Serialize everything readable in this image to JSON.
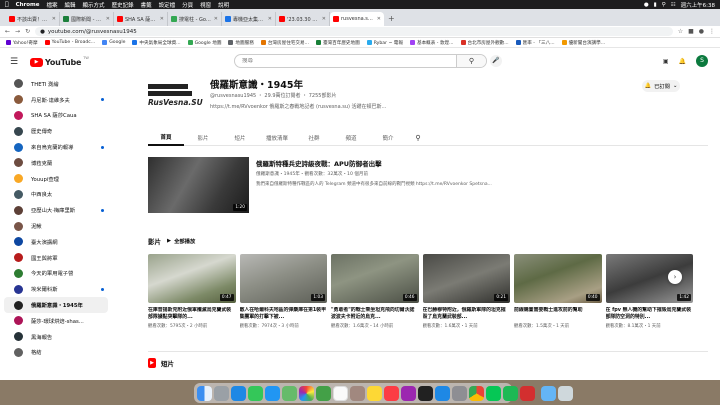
{
  "menubar": {
    "app": "Chrome",
    "items": [
      "檔案",
      "編輯",
      "顯示方式",
      "歷史記錄",
      "書籤",
      "設定檔",
      "分頁",
      "視窗",
      "說明"
    ],
    "clock": "週六上午6:38"
  },
  "tabs": [
    {
      "title": "不該出賣！國1南向桃園段重大事故",
      "color": "#ff0000"
    },
    {
      "title": "國際新聞 - Mobile01",
      "color": "#1b7f3b"
    },
    {
      "title": "SHA SA 薩莎 Caua - YouTube",
      "color": "#ff0000"
    },
    {
      "title": "搜電柱 - Google 地圖",
      "color": "#34a853"
    },
    {
      "title": "專機亞太集結 (重要觀察)",
      "color": "#1a73e8"
    },
    {
      "title": "'23.03.30 【世界一把抓】",
      "color": "#ff0000"
    },
    {
      "title": "rusvesna.su1945 - YouTube",
      "color": "#ff0000",
      "active": true
    }
  ],
  "address": {
    "url": "youtube.com/@rusvesnasu1945"
  },
  "bookmarks": [
    {
      "label": "Yahoo!奇摩",
      "color": "#6001d2"
    },
    {
      "label": "YouTube - Broadc...",
      "color": "#ff0000"
    },
    {
      "label": "Google",
      "color": "#4285f4"
    },
    {
      "label": "中央氣象局全球資...",
      "color": "#1a73e8"
    },
    {
      "label": "Google 地圖",
      "color": "#34a853"
    },
    {
      "label": "地圖服務",
      "color": "#5f6368"
    },
    {
      "label": "台灣房屋住宅交易...",
      "color": "#e37400"
    },
    {
      "label": "臺灣百年歷史地圖",
      "color": "#188038"
    },
    {
      "label": "Rybar ~ 電報",
      "color": "#2aabee"
    },
    {
      "label": "基本概表 - 敦煌...",
      "color": "#a142f4"
    },
    {
      "label": "台北市房屋外觀數...",
      "color": "#d93025"
    },
    {
      "label": "匯率 - 「三八...",
      "color": "#185abc"
    },
    {
      "label": "優新聞台演講學...",
      "color": "#f29900"
    }
  ],
  "youtube": {
    "logo_text": "YouTube",
    "region": "TW",
    "search_placeholder": "搜尋",
    "sidebar": [
      {
        "label": "THETI 測繪",
        "color": "#555555"
      },
      {
        "label": "丹尼斯·達維多夫",
        "color": "#8a5a3c",
        "dot": true
      },
      {
        "label": "SHA SA 薩莎Caua",
        "color": "#c2185b"
      },
      {
        "label": "歷史傳奇",
        "color": "#37474f"
      },
      {
        "label": "來自烏克蘭的報導",
        "color": "#1565c0",
        "dot": true
      },
      {
        "label": "博菈克蘭",
        "color": "#6d4c41"
      },
      {
        "label": "Youupi查理",
        "color": "#f9a825"
      },
      {
        "label": "中西良太",
        "color": "#455a64"
      },
      {
        "label": "亞歷山大·梅庫里斯",
        "color": "#5d4037",
        "dot": true
      },
      {
        "label": "泥鰍",
        "color": "#795548"
      },
      {
        "label": "臺大演講網",
        "color": "#0d47a1"
      },
      {
        "label": "國王與將軍",
        "color": "#b71c1c"
      },
      {
        "label": "今天的軍用電子營",
        "color": "#2e7d32"
      },
      {
        "label": "埃米爾科斯",
        "color": "#283593",
        "dot": true
      },
      {
        "label": "俄羅斯意識・1945年",
        "color": "#212121",
        "active": true
      },
      {
        "label": "薩莎-環球烘焙-shas...",
        "color": "#ad1457"
      },
      {
        "label": "黑海報告",
        "color": "#263238"
      },
      {
        "label": "格結",
        "color": "#616161"
      }
    ],
    "channel": {
      "logo_text": "RusVesna.SU",
      "name": "俄羅斯意識・1945年",
      "handle": "@rusvesnasu1945",
      "subscribers": "29.9萬位訂閱者",
      "video_count": "7255部影片",
      "description": "https://t.me/RVvoenkor 俄羅斯之春戰地記者 (rusvesna.su) 活躍在頓巴斯...",
      "subscribed_label": "已訂閱",
      "tabs": [
        "首頁",
        "影片",
        "短片",
        "播放清單",
        "社群",
        "頻道",
        "簡介"
      ]
    },
    "featured": {
      "title": "俄羅斯特種兵史詩級夜戰：APU防御者出擊",
      "meta": "俄羅斯意識・1945年・觀看次數：32萬次・10 個月前",
      "description": "我們來自俄羅斯特種作戰區的人的 Telegram 頻道中有很多來自前線的戰鬥視頻 https://t.me/RVvoenkor Spetsna...",
      "duration": "1:20"
    },
    "shelf": {
      "title": "影片",
      "play_all": "全部播放"
    },
    "videos": [
      {
        "title": "在庫普揚斯克附近俄軍殲滅烏克蘭武裝部隊據點突擊隊的...",
        "meta": "觀看次數：5795次・2 小時前",
        "duration": "0:47"
      },
      {
        "title": "敵人在哈爾科夫地區的彈藥庫在第1裝甲集團軍的打擊下被...",
        "meta": "觀看次數：7974次・3 小時前",
        "duration": "1:03"
      },
      {
        "title": "\"勇敢者\"的戰士乘坐坦克飛向切爾沃諾波波夫卡附近的烏克...",
        "meta": "觀看次數：1.6萬次・14 小時前",
        "duration": "0:46"
      },
      {
        "title": "在巴赫穆特附近，俄羅斯軍隊的坦克摧毀了烏克蘭武裝部...",
        "meta": "觀看次數：1.6萬次・1 天前",
        "duration": "0:21"
      },
      {
        "title": "前線購置需要戰士進攻前的幫助",
        "meta": "觀看次數：1.5萬次・1 天前",
        "duration": "0:40"
      },
      {
        "title": "在 fpv 無人機的幫助下摧毀烏克蘭武裝部隊防空洞的特別...",
        "meta": "觀看次數：8.1萬次・1 天前",
        "duration": "1:42"
      }
    ],
    "shorts_title": "短片"
  }
}
